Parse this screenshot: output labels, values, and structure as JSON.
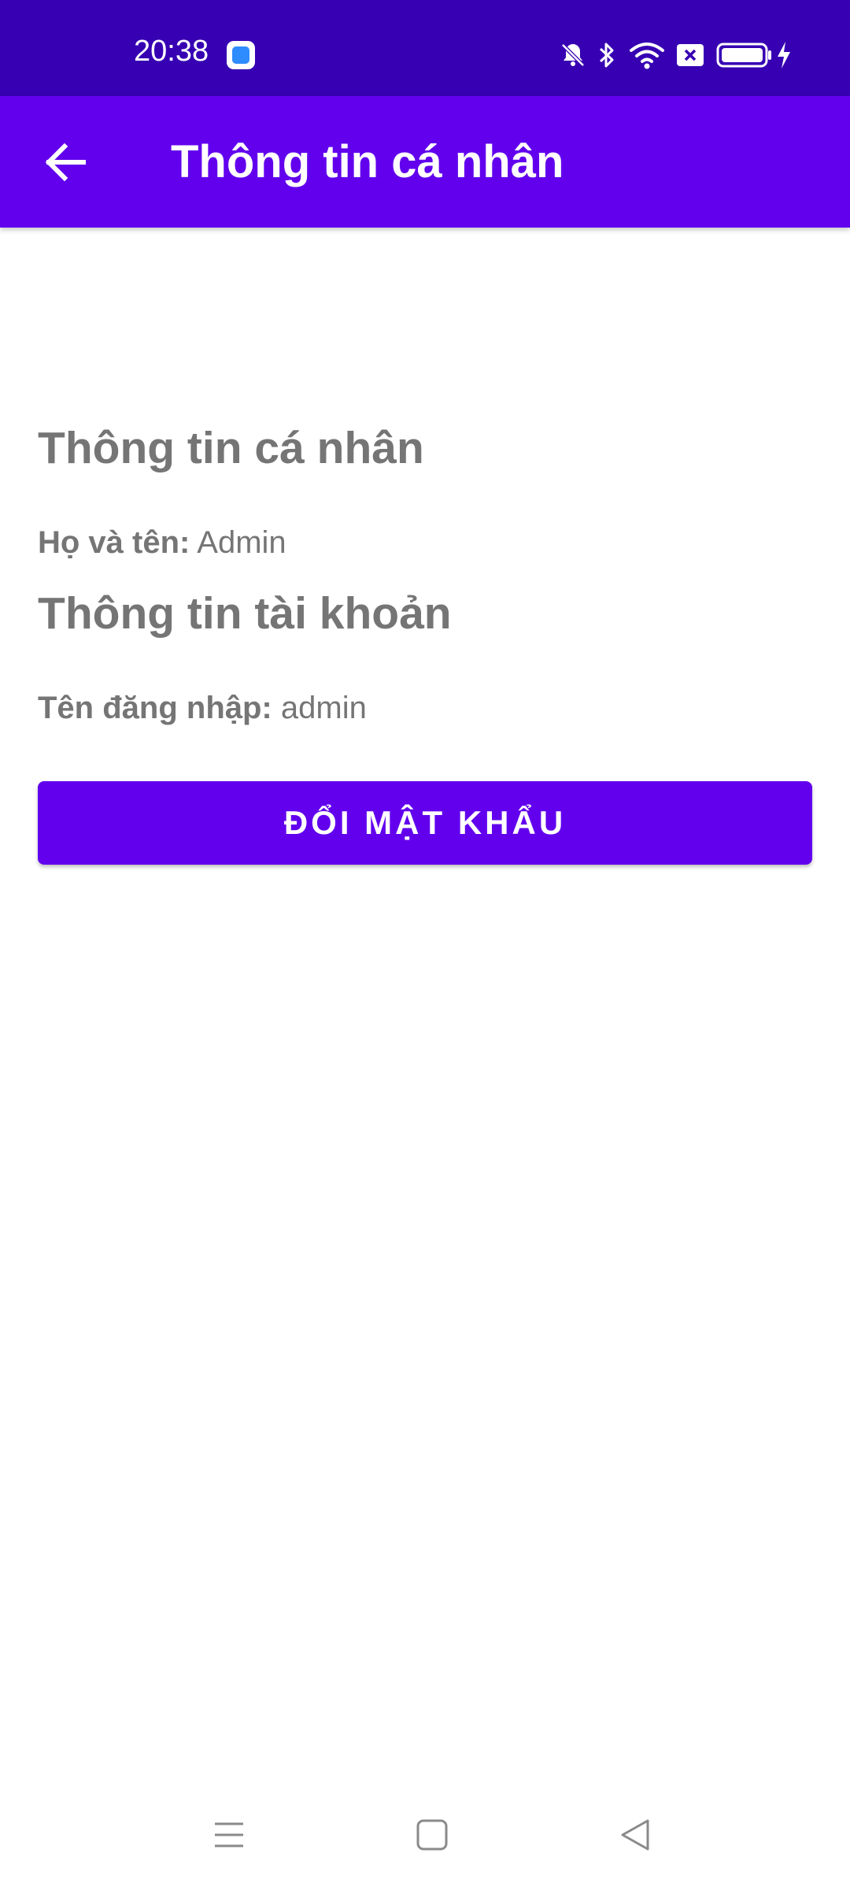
{
  "status_bar": {
    "time": "20:38",
    "icons": [
      "app-notification-icon",
      "bell-off-icon",
      "bluetooth-icon",
      "wifi-icon",
      "sim-off-icon",
      "battery-icon",
      "charging-icon"
    ]
  },
  "app_bar": {
    "back_icon": "arrow-left-icon",
    "title": "Thông tin cá nhân"
  },
  "content": {
    "personal_heading": "Thông tin cá nhân",
    "full_name_label": "Họ và tên:",
    "full_name_value": "Admin",
    "account_heading": "Thông tin tài khoản",
    "username_label": "Tên đăng nhập:",
    "username_value": "admin",
    "change_password_button": "ĐỔI MẬT KHẨU"
  },
  "navigation_bar": {
    "icons": [
      "menu-icon",
      "home-icon",
      "back-icon"
    ]
  },
  "colors": {
    "status_bar": "#3700b3",
    "primary": "#6200ee",
    "text_gray": "#757575",
    "background": "#ffffff"
  }
}
